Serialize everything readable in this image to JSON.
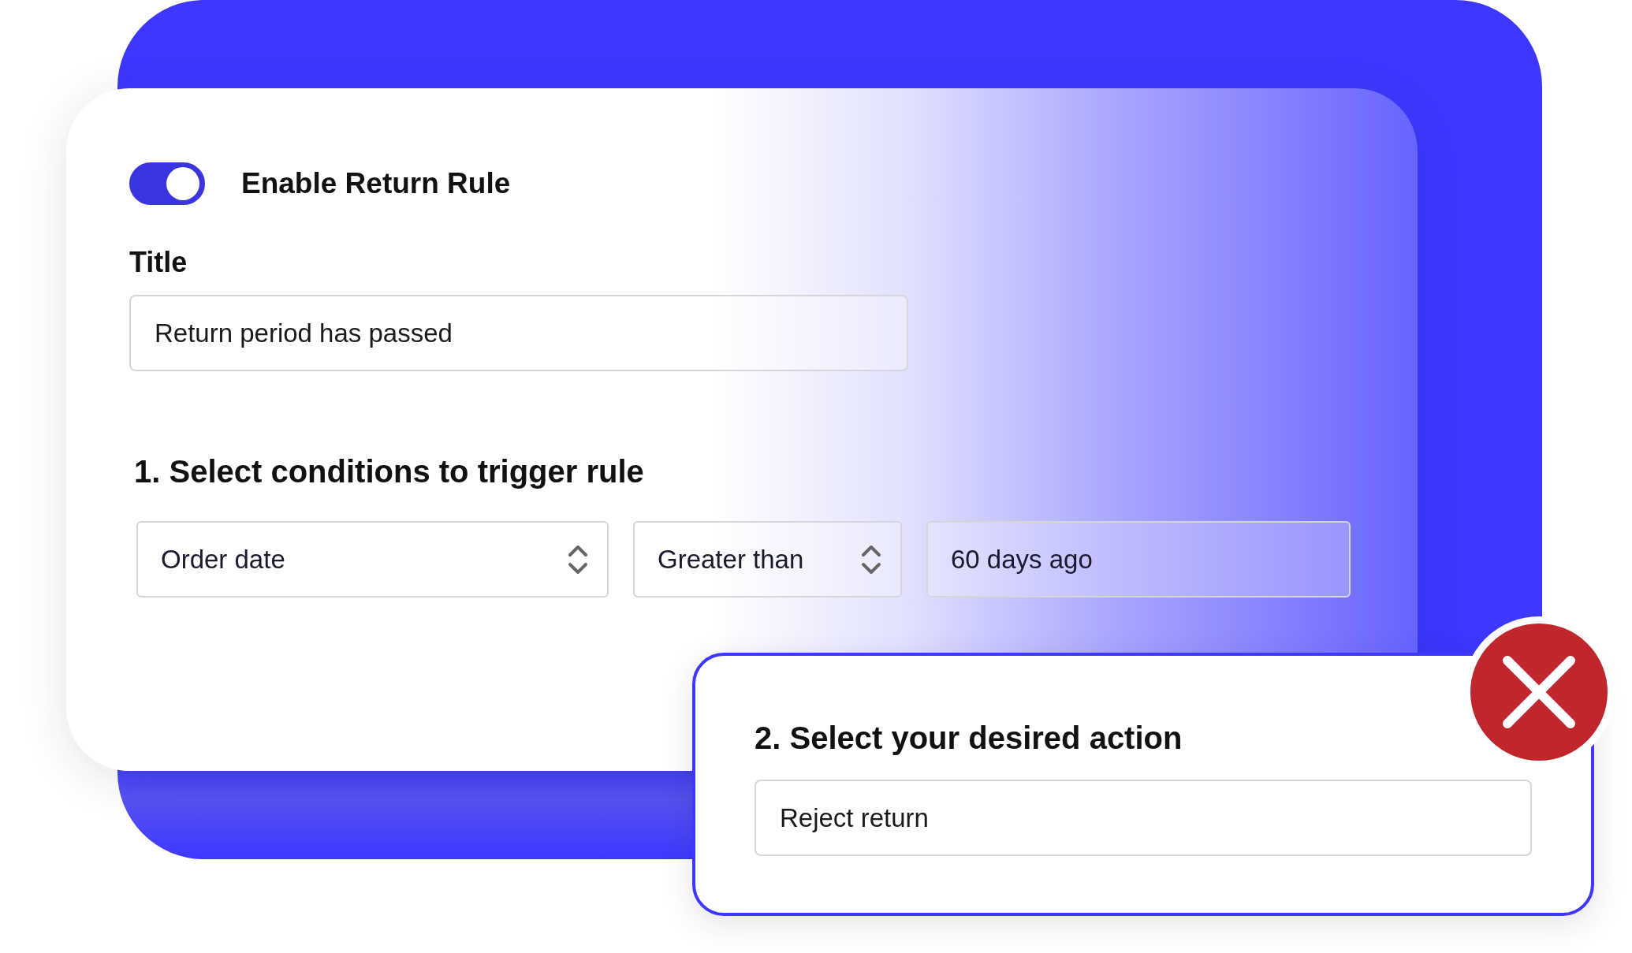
{
  "rule_toggle": {
    "label": "Enable Return Rule",
    "on": true
  },
  "title_field": {
    "label": "Title",
    "value": "Return period has passed"
  },
  "conditions": {
    "heading": "1. Select conditions to trigger rule",
    "fields": [
      {
        "kind": "select",
        "value": "Order date"
      },
      {
        "kind": "select",
        "value": "Greater than"
      },
      {
        "kind": "input",
        "value": "60 days ago"
      }
    ]
  },
  "action": {
    "heading": "2. Select your desired action",
    "value": "Reject return",
    "rejected": true
  }
}
